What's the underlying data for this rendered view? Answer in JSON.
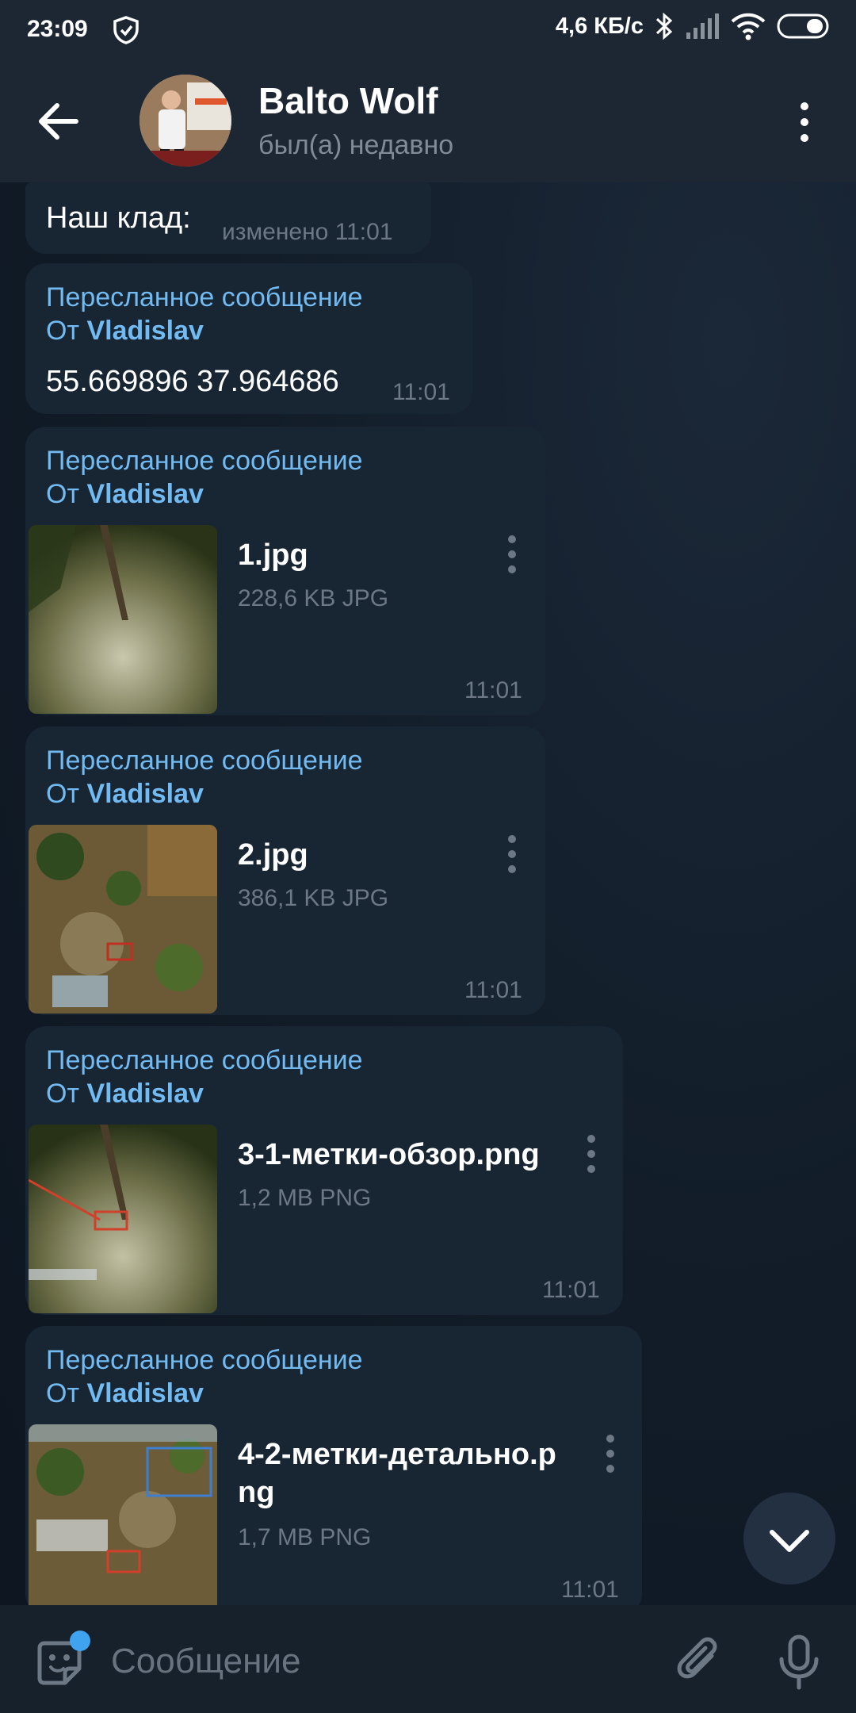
{
  "status_bar": {
    "time": "23:09",
    "network_speed": "4,6 КБ/с",
    "icons": [
      "shield-icon",
      "bluetooth-icon",
      "signal-icon",
      "wifi-icon",
      "battery-icon"
    ]
  },
  "header": {
    "contact_name": "Balto Wolf",
    "contact_status": "был(а) недавно",
    "icons": [
      "back-arrow-icon",
      "avatar",
      "more-vertical-icon"
    ]
  },
  "messages": [
    {
      "type": "text",
      "text": "Наш клад:",
      "time": "изменено 11:01"
    },
    {
      "type": "forwarded_text",
      "forward_title": "Пересланное сообщение",
      "forward_prefix": "От",
      "forward_from": "Vladislav",
      "text": "55.669896 37.964686",
      "time": "11:01"
    },
    {
      "type": "forwarded_file",
      "forward_title": "Пересланное сообщение",
      "forward_prefix": "От",
      "forward_from": "Vladislav",
      "file_name": "1.jpg",
      "file_meta": "228,6 KB JPG",
      "time": "11:01"
    },
    {
      "type": "forwarded_file",
      "forward_title": "Пересланное сообщение",
      "forward_prefix": "От",
      "forward_from": "Vladislav",
      "file_name": "2.jpg",
      "file_meta": "386,1 KB JPG",
      "time": "11:01"
    },
    {
      "type": "forwarded_file",
      "forward_title": "Пересланное сообщение",
      "forward_prefix": "От",
      "forward_from": "Vladislav",
      "file_name": "3-1-метки-обзор.png",
      "file_meta": "1,2 MB PNG",
      "time": "11:01"
    },
    {
      "type": "forwarded_file",
      "forward_title": "Пересланное сообщение",
      "forward_prefix": "От",
      "forward_from": "Vladislav",
      "file_name_line1": "4-2-метки-детально.p",
      "file_name_line2": "ng",
      "file_meta": "1,7 MB PNG",
      "time": "11:01"
    }
  ],
  "composer": {
    "placeholder": "Сообщение",
    "value": "",
    "icons": [
      "sticker-icon",
      "paperclip-icon",
      "microphone-icon"
    ],
    "sticker_badge_color": "#3fa3ef"
  },
  "scroll_down_icon": "chevron-down-icon",
  "colors": {
    "background": "#0e1621",
    "header": "#1d2733",
    "bubble": "#182533",
    "accent_link": "#71baf2",
    "muted_text": "#6c7884"
  }
}
